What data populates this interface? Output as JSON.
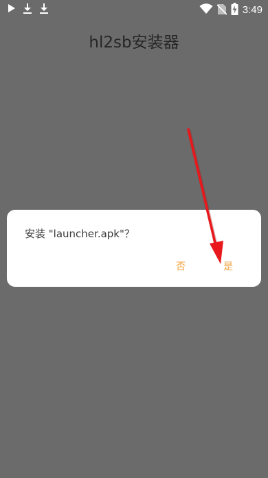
{
  "status_bar": {
    "time": "3:49",
    "icons": [
      "play-icon",
      "download-icon",
      "download-icon",
      "wifi-icon",
      "no-sim-icon",
      "battery-charging-icon"
    ]
  },
  "app": {
    "title": "hl2sb安装器"
  },
  "dialog": {
    "message": "安装 \"launcher.apk\"？",
    "cancel_label": "否",
    "confirm_label": "是",
    "button_color": "#f0a23c"
  },
  "colors": {
    "background": "#6b6b6b",
    "annotation_arrow": "#e8181c"
  }
}
